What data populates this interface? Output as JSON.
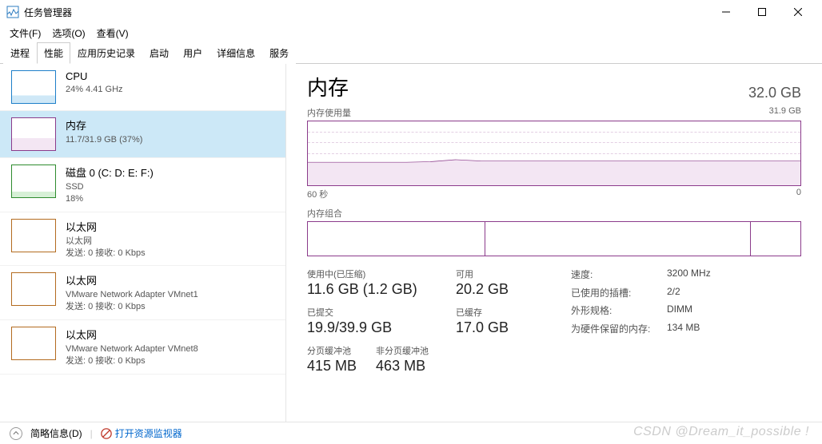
{
  "window": {
    "title": "任务管理器"
  },
  "menus": [
    "文件(F)",
    "选项(O)",
    "查看(V)"
  ],
  "tabs": [
    "进程",
    "性能",
    "应用历史记录",
    "启动",
    "用户",
    "详细信息",
    "服务"
  ],
  "active_tab": 1,
  "sidebar": [
    {
      "name": "CPU",
      "sub1": "24% 4.41 GHz",
      "sub2": "",
      "type": "cpu"
    },
    {
      "name": "内存",
      "sub1": "11.7/31.9 GB (37%)",
      "sub2": "",
      "type": "mem",
      "selected": true
    },
    {
      "name": "磁盘 0 (C: D: E: F:)",
      "sub1": "SSD",
      "sub2": "18%",
      "type": "disk"
    },
    {
      "name": "以太网",
      "sub1": "以太网",
      "sub2": "发送: 0 接收: 0 Kbps",
      "type": "eth1"
    },
    {
      "name": "以太网",
      "sub1": "VMware Network Adapter VMnet1",
      "sub2": "发送: 0 接收: 0 Kbps",
      "type": "blank"
    },
    {
      "name": "以太网",
      "sub1": "VMware Network Adapter VMnet8",
      "sub2": "发送: 0 接收: 0 Kbps",
      "type": "blank"
    }
  ],
  "main": {
    "title": "内存",
    "total": "32.0 GB",
    "usage_label": "内存使用量",
    "usage_max": "31.9 GB",
    "x_left": "60 秒",
    "x_right": "0",
    "composition_label": "内存组合",
    "stats": {
      "in_use_label": "使用中(已压缩)",
      "in_use": "11.6 GB (1.2 GB)",
      "available_label": "可用",
      "available": "20.2 GB",
      "committed_label": "已提交",
      "committed": "19.9/39.9 GB",
      "cached_label": "已缓存",
      "cached": "17.0 GB",
      "paged_label": "分页缓冲池",
      "paged": "415 MB",
      "nonpaged_label": "非分页缓冲池",
      "nonpaged": "463 MB"
    },
    "spec": {
      "speed_k": "速度:",
      "speed_v": "3200 MHz",
      "slots_k": "已使用的插槽:",
      "slots_v": "2/2",
      "form_k": "外形规格:",
      "form_v": "DIMM",
      "hw_k": "为硬件保留的内存:",
      "hw_v": "134 MB"
    }
  },
  "footer": {
    "brief": "简略信息(D)",
    "resmon": "打开资源监视器"
  },
  "watermark": "CSDN @Dream_it_possible !",
  "chart_data": {
    "type": "area",
    "title": "内存使用量",
    "ylabel": "GB",
    "ylim": [
      0,
      31.9
    ],
    "xlabel": "秒",
    "xlim": [
      60,
      0
    ],
    "series": [
      {
        "name": "内存使用量",
        "values_gb": [
          11.4,
          11.4,
          11.4,
          11.4,
          11.5,
          11.8,
          11.9,
          11.9,
          11.8,
          11.8,
          11.8,
          11.8,
          11.8,
          11.8,
          11.8,
          11.8,
          11.8,
          11.8,
          11.8,
          11.8
        ]
      }
    ],
    "composition_segments_pct": [
      36,
      54,
      10
    ]
  }
}
